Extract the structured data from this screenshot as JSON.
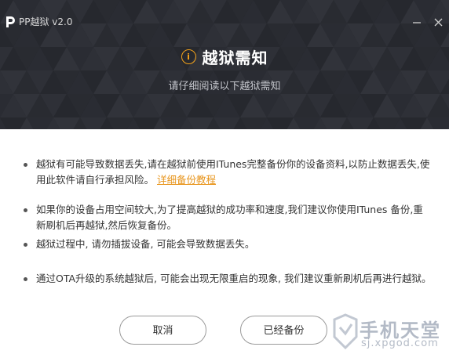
{
  "window": {
    "title": "PP越狱 v2.0",
    "minimize_icon": "minimize-icon",
    "close_icon": "close-icon"
  },
  "header": {
    "heading": "越狱需知",
    "subheading": "请仔细阅读以下越狱需知",
    "icon": "info-icon",
    "background_color": "#24262c",
    "accent_color": "#f3a21b"
  },
  "notices": [
    {
      "text": "越狱有可能导致数据丢失,请在越狱前使用ITunes完整备份你的设备资料,以防止数据丢失,使用此软件请自行承担风险。",
      "link": "详细备份教程"
    },
    {
      "text": "如果你的设备占用空间较大,为了提高越狱的成功率和速度,我们建议你使用ITunes 备份,重新刷机后再越狱,然后恢复备份。"
    },
    {
      "text": "越狱过程中, 请勿插拔设备, 可能会导致数据丢失。"
    },
    {
      "text": "通过OTA升级的系统越狱后, 可能会出现无限重启的现象, 我们建议重新刷机后再进行越狱。"
    }
  ],
  "buttons": {
    "cancel": "取消",
    "backed_up": "已经备份"
  },
  "watermark": {
    "text": "手机天堂",
    "url": "sj.xpgod.com"
  }
}
